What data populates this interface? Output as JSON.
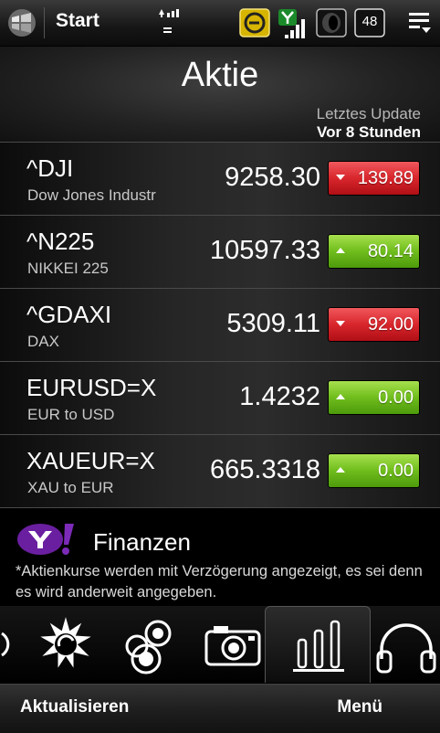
{
  "statusbar": {
    "start_label": "Start",
    "badge_number": "48",
    "icons": [
      "windows-logo-icon",
      "network-icon",
      "notification-icon",
      "signal-icon",
      "volume-icon",
      "battery-icon",
      "menu-icon"
    ]
  },
  "header": {
    "title": "Aktie",
    "update_label": "Letztes Update",
    "update_value": "Vor 8 Stunden"
  },
  "stocks": [
    {
      "symbol": "^DJI",
      "name": "Dow Jones Industr",
      "price": "9258.30",
      "change": "139.89",
      "direction": "down"
    },
    {
      "symbol": "^N225",
      "name": "NIKKEI 225",
      "price": "10597.33",
      "change": "80.14",
      "direction": "up"
    },
    {
      "symbol": "^GDAXI",
      "name": "DAX",
      "price": "5309.11",
      "change": "92.00",
      "direction": "down"
    },
    {
      "symbol": "EURUSD=X",
      "name": "EUR to USD",
      "price": "1.4232",
      "change": "0.00",
      "direction": "up"
    },
    {
      "symbol": "XAUEUR=X",
      "name": "XAU to EUR",
      "price": "665.3318",
      "change": "0.00",
      "direction": "up"
    }
  ],
  "footer": {
    "provider_logo": "Y!",
    "provider_label": "Finanzen",
    "disclaimer": "*Aktienkurse werden mit Verzögerung angezeigt, es sei denn es wird anderweit angegeben."
  },
  "tabs": [
    "weather-icon",
    "photo-album-icon",
    "camera-icon",
    "stocks-icon",
    "music-icon"
  ],
  "active_tab": "stocks-icon",
  "softkeys": {
    "left": "Aktualisieren",
    "right": "Menü"
  },
  "colors": {
    "down": "#d8262c",
    "up": "#6fbd1c",
    "background": "#000000"
  }
}
